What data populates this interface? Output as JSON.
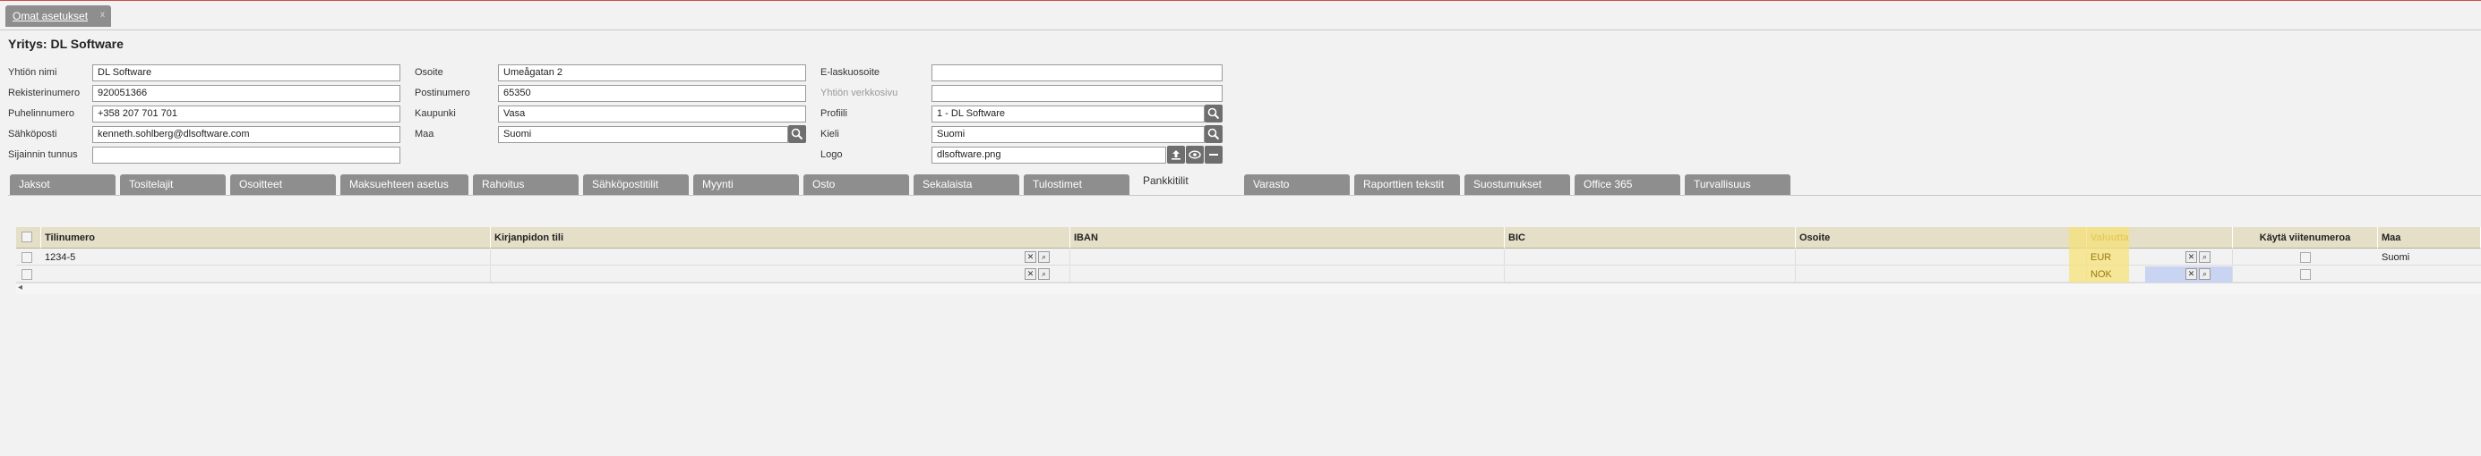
{
  "doc_tab": {
    "label": "Omat asetukset",
    "close": "x"
  },
  "title": "Yritys: DL Software",
  "form": {
    "company_name_label": "Yhtiön nimi",
    "company_name": "DL Software",
    "reg_label": "Rekisterinumero",
    "reg": "920051366",
    "phone_label": "Puhelinnumero",
    "phone": "+358 207 701 701",
    "email_label": "Sähköposti",
    "email": "kenneth.sohlberg@dlsoftware.com",
    "location_label": "Sijainnin tunnus",
    "location": "",
    "address_label": "Osoite",
    "address": "Umeågatan 2",
    "postal_label": "Postinumero",
    "postal": "65350",
    "city_label": "Kaupunki",
    "city": "Vasa",
    "country_label": "Maa",
    "country": "Suomi",
    "einvoice_label": "E-laskuosoite",
    "einvoice": "",
    "website_label": "Yhtiön verkkosivu",
    "website": "",
    "profile_label": "Profiili",
    "profile": "1 - DL Software",
    "language_label": "Kieli",
    "language": "Suomi",
    "logo_label": "Logo",
    "logo": "dlsoftware.png"
  },
  "section_tabs": [
    "Jaksot",
    "Tositelajit",
    "Osoitteet",
    "Maksuehteen asetus",
    "Rahoitus",
    "Sähköpostitilit",
    "Myynti",
    "Osto",
    "Sekalaista",
    "Tulostimet",
    "Pankkitilit",
    "Varasto",
    "Raporttien tekstit",
    "Suostumukset",
    "Office 365",
    "Turvallisuus"
  ],
  "active_tab": "Pankkitilit",
  "grid": {
    "headers": {
      "account": "Tilinumero",
      "ledger": "Kirjanpidon tili",
      "iban": "IBAN",
      "bic": "BIC",
      "address": "Osoite",
      "currency": "Valuutta",
      "reference": "Käytä viitenumeroa",
      "country": "Maa"
    },
    "rows": [
      {
        "account": "1234-5",
        "ledger": "",
        "iban": "",
        "bic": "",
        "address": "",
        "currency": "EUR",
        "country": "Suomi"
      },
      {
        "account": "",
        "ledger": "",
        "iban": "",
        "bic": "",
        "address": "",
        "currency": "NOK",
        "country": ""
      }
    ]
  },
  "colors": {
    "tab": "#8e8e8e",
    "header": "#e4dfc6",
    "highlight": "#f5e27a",
    "selected": "#c9d3f2"
  }
}
